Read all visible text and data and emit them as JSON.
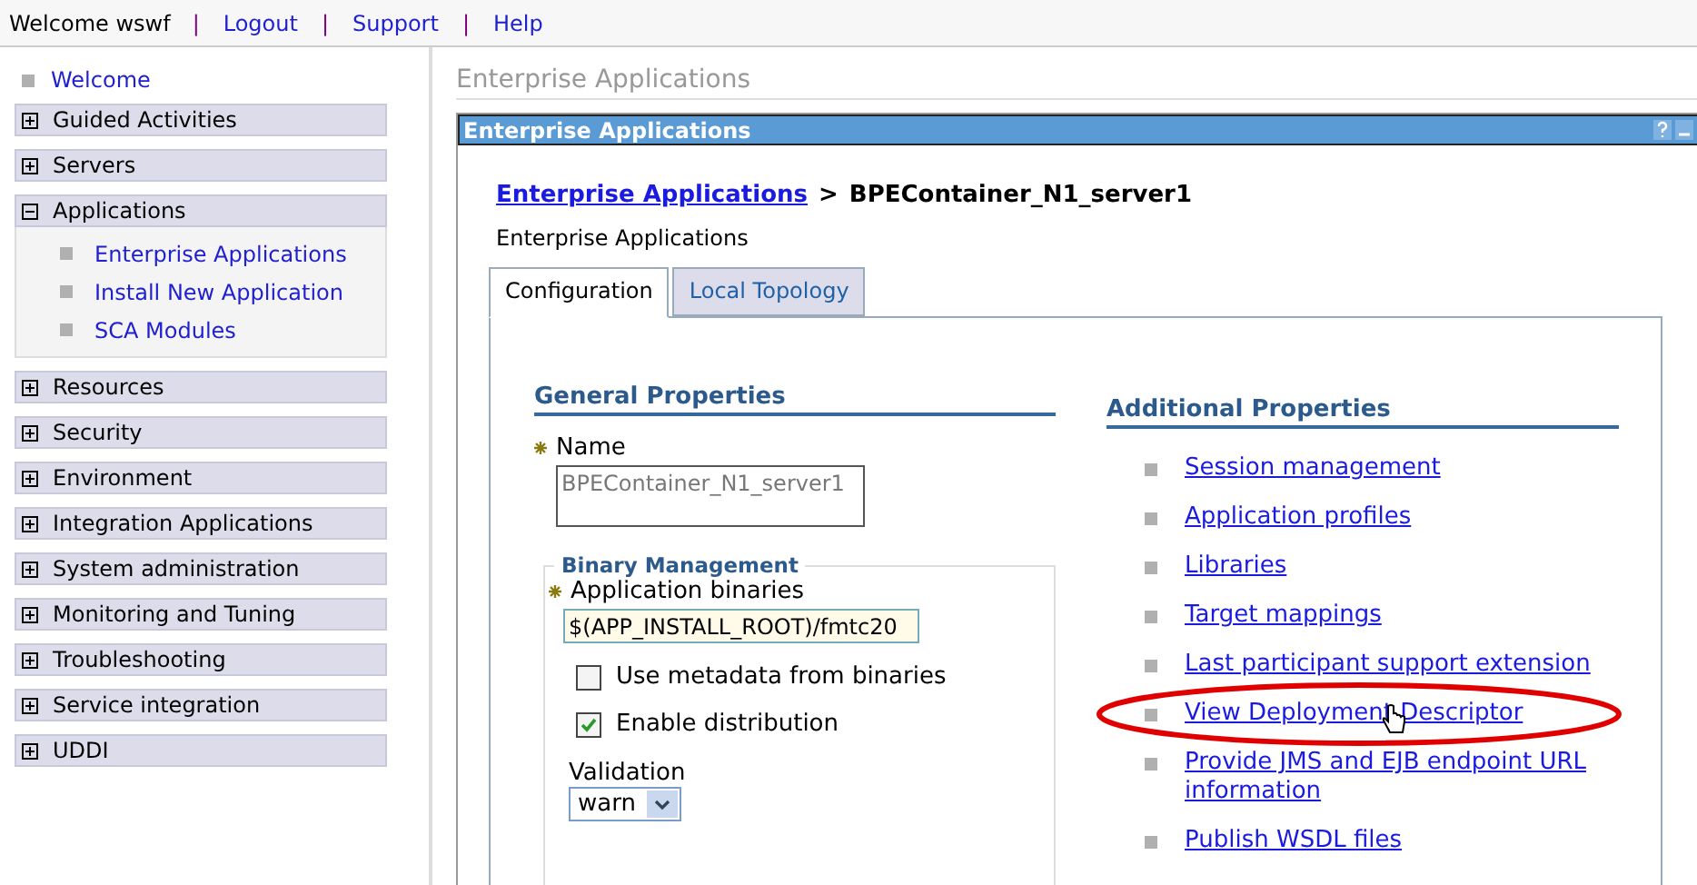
{
  "header": {
    "items": [
      {
        "kind": "text",
        "text": "Welcome wswf"
      },
      {
        "kind": "separator",
        "text": "|"
      },
      {
        "kind": "link",
        "text": "Logout"
      },
      {
        "kind": "separator",
        "text": "|"
      },
      {
        "kind": "link",
        "text": "Support"
      },
      {
        "kind": "separator",
        "text": "|"
      },
      {
        "kind": "link",
        "text": "Help"
      }
    ]
  },
  "sidebar": {
    "items": [
      {
        "kind": "link",
        "label": "Welcome"
      },
      {
        "kind": "group",
        "label": "Guided Activities",
        "expanded": false
      },
      {
        "kind": "group",
        "label": "Servers",
        "expanded": false
      },
      {
        "kind": "group",
        "label": "Applications",
        "expanded": true,
        "children": [
          {
            "label": "Enterprise Applications"
          },
          {
            "label": "Install New Application"
          },
          {
            "label": "SCA Modules"
          }
        ]
      },
      {
        "kind": "group",
        "label": "Resources",
        "expanded": false
      },
      {
        "kind": "group",
        "label": "Security",
        "expanded": false
      },
      {
        "kind": "group",
        "label": "Environment",
        "expanded": false
      },
      {
        "kind": "group",
        "label": "Integration Applications",
        "expanded": false
      },
      {
        "kind": "group",
        "label": "System administration",
        "expanded": false
      },
      {
        "kind": "group",
        "label": "Monitoring and Tuning",
        "expanded": false
      },
      {
        "kind": "group",
        "label": "Troubleshooting",
        "expanded": false
      },
      {
        "kind": "group",
        "label": "Service integration",
        "expanded": false
      },
      {
        "kind": "group",
        "label": "UDDI",
        "expanded": false
      }
    ]
  },
  "page_title": "Enterprise Applications",
  "panel": {
    "title": "Enterprise Applications",
    "breadcrumb": {
      "link": "Enterprise Applications",
      "separator": ">",
      "current": "BPEContainer_N1_server1"
    },
    "subtitle": "Enterprise Applications",
    "tabs": [
      {
        "label": "Configuration",
        "selected": true
      },
      {
        "label": "Local Topology",
        "selected": false
      }
    ],
    "general": {
      "heading": "General Properties",
      "name": {
        "label": "Name",
        "required": true,
        "disabled": true,
        "value": "BPEContainer_N1_server1"
      },
      "binary_management": {
        "legend": "Binary Management",
        "binaries": {
          "label": "Application binaries",
          "required": true,
          "value": "$(APP_INSTALL_ROOT)/fmtc20"
        },
        "checkboxes": [
          {
            "label": "Use metadata from binaries",
            "checked": false
          },
          {
            "label": "Enable distribution",
            "checked": true
          }
        ],
        "validation": {
          "label": "Validation",
          "value": "warn"
        }
      }
    },
    "additional": {
      "heading": "Additional Properties",
      "links": [
        {
          "label": "Session management",
          "highlighted": false
        },
        {
          "label": "Application profiles",
          "highlighted": false
        },
        {
          "label": "Libraries",
          "highlighted": false
        },
        {
          "label": "Target mappings",
          "highlighted": false
        },
        {
          "label": "Last participant support extension",
          "highlighted": false
        },
        {
          "label": "View Deployment Descriptor",
          "highlighted": true
        },
        {
          "label": "Provide JMS and EJB endpoint URL information",
          "highlighted": false
        },
        {
          "label": "Publish WSDL files",
          "highlighted": false
        }
      ]
    }
  }
}
